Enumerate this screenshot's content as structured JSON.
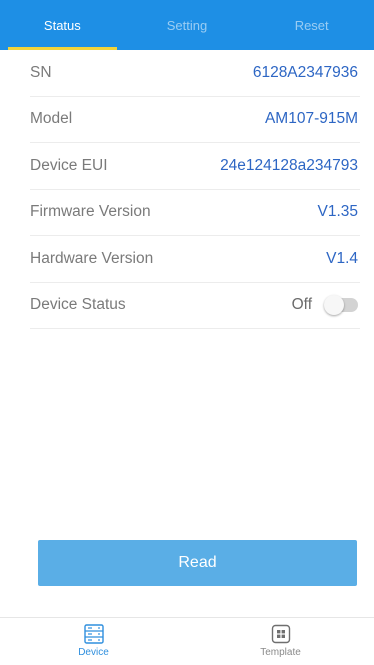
{
  "tabs": [
    {
      "label": "Status",
      "active": true
    },
    {
      "label": "Setting",
      "active": false
    },
    {
      "label": "Reset",
      "active": false
    }
  ],
  "rows": [
    {
      "label": "SN",
      "value": "6128A2347936"
    },
    {
      "label": "Model",
      "value": "AM107-915M"
    },
    {
      "label": "Device EUI",
      "value": "24e124128a234793"
    },
    {
      "label": "Firmware Version",
      "value": "V1.35"
    },
    {
      "label": "Hardware Version",
      "value": "V1.4"
    }
  ],
  "device_status": {
    "label": "Device Status",
    "value": "Off",
    "toggle_on": false
  },
  "read_button": {
    "label": "Read"
  },
  "bottom_nav": [
    {
      "label": "Device",
      "icon": "device-icon",
      "active": true
    },
    {
      "label": "Template",
      "icon": "template-icon",
      "active": false
    }
  ],
  "colors": {
    "tab_bar": "#1e8fe5",
    "tab_indicator": "#f2d43a",
    "value_text": "#2d66c4",
    "read_button": "#5aaee6",
    "nav_active": "#2f8fde"
  }
}
